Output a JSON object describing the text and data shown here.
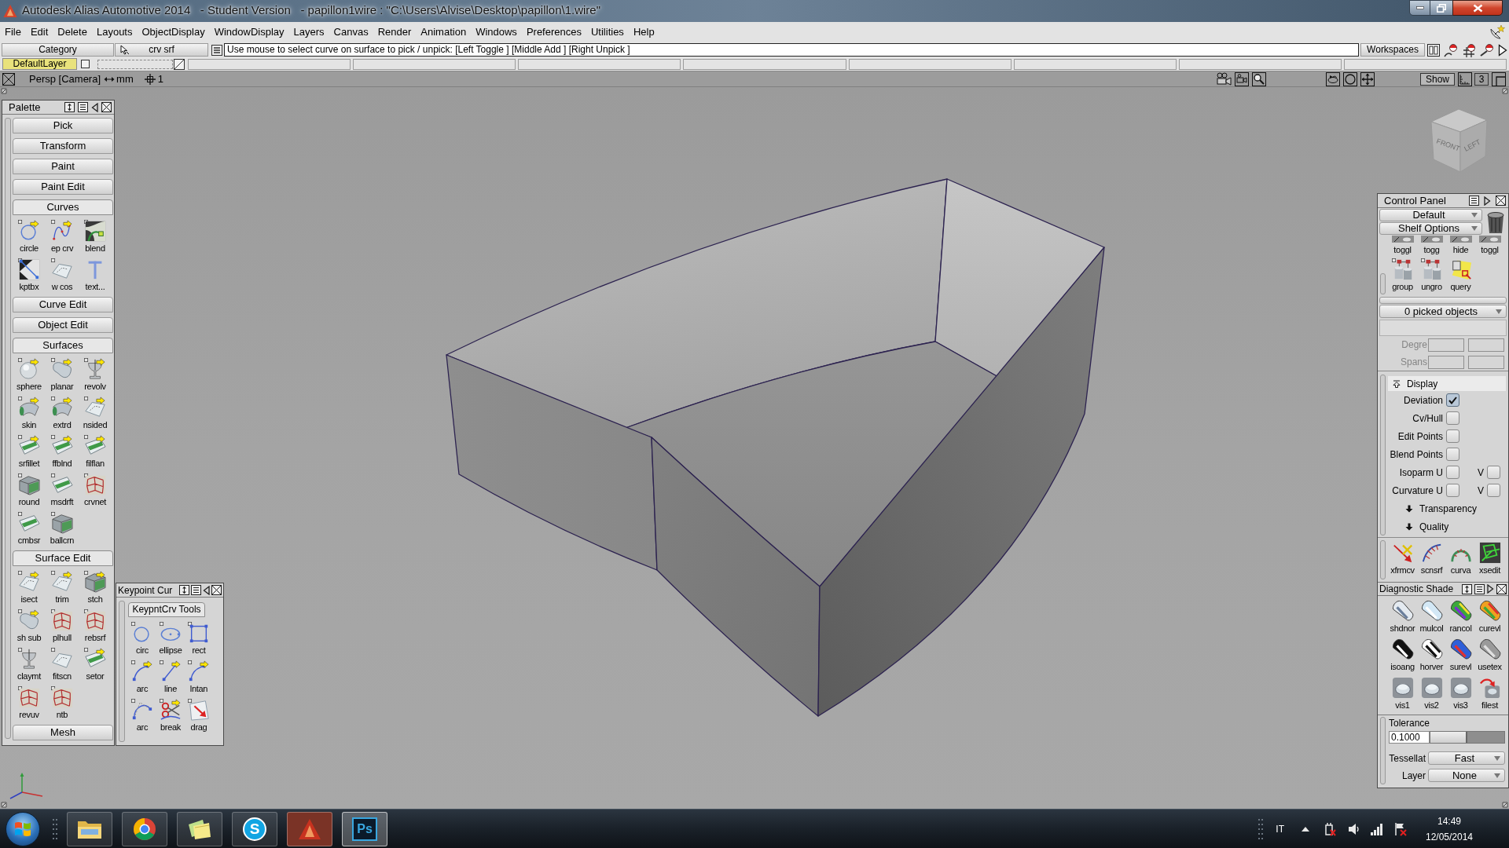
{
  "window": {
    "title": "Autodesk Alias Automotive 2014   - Student Version   - papillon1wire : \"C:\\Users\\Alvise\\Desktop\\papillon\\1.wire\""
  },
  "menu": [
    "File",
    "Edit",
    "Delete",
    "Layouts",
    "ObjectDisplay",
    "WindowDisplay",
    "Layers",
    "Canvas",
    "Render",
    "Animation",
    "Windows",
    "Preferences",
    "Utilities",
    "Help"
  ],
  "toolbar": {
    "category": "Category",
    "tool": "crv srf",
    "prompt": "Use mouse to select curve on surface to pick / unpick: [Left Toggle ] [Middle Add ] [Right Unpick ]",
    "workspaces": "Workspaces"
  },
  "layer_bar": {
    "layers": [
      {
        "label": "DefaultLayer",
        "selected": true
      }
    ],
    "layer_toggle": {
      "checked": false
    }
  },
  "viewport": {
    "camera": "Persp [Camera]",
    "units": "mm",
    "grid": "1",
    "show": "Show",
    "layout": "3",
    "view_cube": [
      "FRONT",
      "LEFT"
    ]
  },
  "palette": {
    "title": "Palette",
    "sections": [
      {
        "kind": "button",
        "label": "Pick"
      },
      {
        "kind": "button",
        "label": "Transform"
      },
      {
        "kind": "button",
        "label": "Paint"
      },
      {
        "kind": "button",
        "label": "Paint Edit"
      },
      {
        "kind": "tab",
        "label": "Curves",
        "tools": [
          "circle",
          "ep crv",
          "blend",
          "kptbx",
          "w cos",
          "text..."
        ]
      },
      {
        "kind": "button",
        "label": "Curve Edit"
      },
      {
        "kind": "button",
        "label": "Object Edit"
      },
      {
        "kind": "tab",
        "label": "Surfaces",
        "tools": [
          "sphere",
          "planar",
          "revolv",
          "skin",
          "extrd",
          "nsided",
          "srfillet",
          "ffblnd",
          "filflan",
          "round",
          "msdrft",
          "crvnet",
          "cmbsr",
          "ballcrn"
        ]
      },
      {
        "kind": "tab",
        "label": "Surface Edit",
        "tools": [
          "isect",
          "trim",
          "stch",
          "sh sub",
          "plhull",
          "rebsrf",
          "claymt",
          "fitscn",
          "setor",
          "revuv",
          "ntb"
        ]
      },
      {
        "kind": "button",
        "label": "Mesh"
      }
    ]
  },
  "keypoint_panel": {
    "title": "Keypoint Cur",
    "tab": "KeypntCrv Tools",
    "tools": [
      "circ",
      "ellipse",
      "rect",
      "arc",
      "line",
      "lntan",
      "arc",
      "break",
      "drag"
    ]
  },
  "control_panel": {
    "title": "Control Panel",
    "preset": "Default",
    "shelf_menu": "Shelf Options",
    "shelf": [
      "toggl",
      "togg",
      "hide",
      "toggl",
      "group",
      "ungro",
      "query"
    ],
    "picked": "0 picked objects",
    "fields": [
      {
        "label": "Degre",
        "disabled": true
      },
      {
        "label": "Spans",
        "disabled": true
      }
    ],
    "sections": [
      {
        "label": "Display",
        "expanded": true,
        "options": [
          {
            "label": "Deviation",
            "checked": true
          },
          {
            "label": "Cv/Hull",
            "checked": false
          },
          {
            "label": "Edit Points",
            "checked": false
          },
          {
            "label": "Blend Points",
            "checked": false
          },
          {
            "label": "Isoparm U",
            "checked": false,
            "v_label": "V",
            "v_checked": false
          },
          {
            "label": "Curvature U",
            "checked": false,
            "v_label": "V",
            "v_checked": false
          }
        ]
      },
      {
        "label": "Transparency",
        "expanded": false
      },
      {
        "label": "Quality",
        "expanded": false
      }
    ],
    "shelf_2": [
      "xfrmcv",
      "scnsrf",
      "curva",
      "xsedit"
    ]
  },
  "diagnostic_shade": {
    "title": "Diagnostic Shade",
    "tools": [
      "shdnor",
      "mulcol",
      "rancol",
      "curevl",
      "isoang",
      "horver",
      "surevl",
      "usetex",
      "vis1",
      "vis2",
      "vis3",
      "filest"
    ],
    "tolerance": {
      "label": "Tolerance",
      "value": "0.1000",
      "level": 0.5
    },
    "tessellator": {
      "label": "Tessellat",
      "value": "Fast"
    },
    "layer": {
      "label": "Layer",
      "value": "None"
    }
  },
  "taskbar": {
    "apps": [
      {
        "kind": "folder"
      },
      {
        "kind": "browser"
      },
      {
        "kind": "notes"
      },
      {
        "kind": "chat",
        "label": "S"
      },
      {
        "kind": "alias"
      },
      {
        "kind": "editor",
        "label": "Ps"
      }
    ],
    "language": "IT",
    "time": "14:49",
    "date": "12/05/2014"
  }
}
